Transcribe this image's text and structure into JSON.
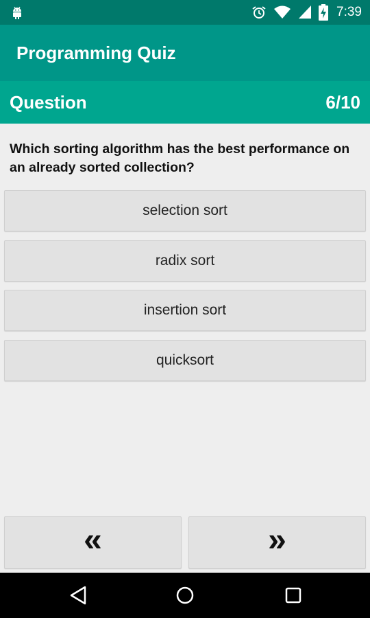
{
  "status_bar": {
    "time": "7:39",
    "icons": [
      "android-icon",
      "alarm-icon",
      "wifi-icon",
      "signal-icon",
      "battery-charging-icon"
    ]
  },
  "app_bar": {
    "title": "Programming Quiz"
  },
  "question_header": {
    "label": "Question",
    "counter": "6/10"
  },
  "question": {
    "text": "Which sorting algorithm has the best performance on an already sorted collection?"
  },
  "answers": [
    {
      "label": "selection sort"
    },
    {
      "label": "radix sort"
    },
    {
      "label": "insertion sort"
    },
    {
      "label": "quicksort"
    }
  ],
  "navigation": {
    "prev_label": "«",
    "next_label": "»"
  },
  "system_nav": {
    "icons": [
      "back-icon",
      "home-icon",
      "recents-icon"
    ]
  },
  "colors": {
    "status_bar": "#00796b",
    "app_bar": "#009688",
    "question_bar": "#00a68f",
    "background": "#eeeeee",
    "button": "#e2e2e2"
  }
}
